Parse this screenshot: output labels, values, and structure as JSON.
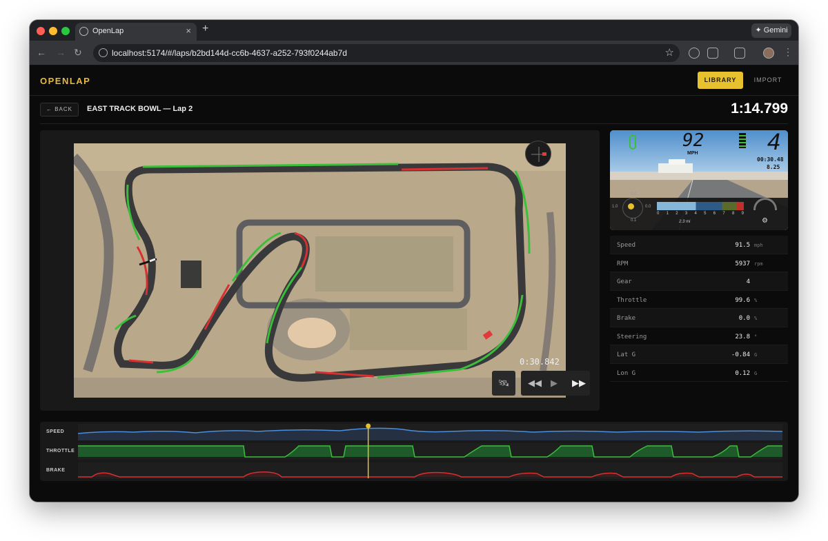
{
  "browser": {
    "tab_title": "OpenLap",
    "url": "localhost:5174/#/laps/b2bd144d-cc6b-4637-a252-793f0244ab7d",
    "gemini_label": "Gemini"
  },
  "header": {
    "brand": "OPENLAP",
    "library_label": "LIBRARY",
    "import_label": "IMPORT"
  },
  "lap": {
    "back_label": "← BACK",
    "title": "EAST TRACK BOWL — Lap 2",
    "lap_time": "1:14.799"
  },
  "playback": {
    "time": "0:30.842",
    "rewind_icon": "rewind-icon",
    "play_icon": "play-icon",
    "forward_icon": "fast-forward-icon"
  },
  "dash": {
    "speed": "92",
    "speed_unit": "MPH",
    "gear": "4",
    "time1": "00:30.48",
    "time2": "8.25",
    "rpm_ticks": [
      "0",
      "1",
      "2",
      "3",
      "4",
      "5",
      "6",
      "7",
      "8",
      "9"
    ],
    "g_labels": [
      "0.0",
      "1.0",
      "0.0",
      "0.1"
    ],
    "distance": "2.3 mi"
  },
  "telemetry_table": [
    {
      "label": "Speed",
      "value": "91.5",
      "unit": "mph"
    },
    {
      "label": "RPM",
      "value": "5937",
      "unit": "rpm"
    },
    {
      "label": "Gear",
      "value": "4",
      "unit": ""
    },
    {
      "label": "Throttle",
      "value": "99.6",
      "unit": "%"
    },
    {
      "label": "Brake",
      "value": "0.0",
      "unit": "%"
    },
    {
      "label": "Steering",
      "value": "23.8",
      "unit": "°"
    },
    {
      "label": "Lat G",
      "value": "-0.84",
      "unit": "G"
    },
    {
      "label": "Lon G",
      "value": "0.12",
      "unit": "G"
    }
  ],
  "traces": {
    "speed_label": "SPEED",
    "throttle_label": "THROTTLE",
    "brake_label": "BRAKE",
    "playhead_fraction": 0.412
  },
  "colors": {
    "accent": "#e7c12e",
    "speed": "#4a8fe0",
    "throttle": "#3bbf3b",
    "brake": "#d83030"
  }
}
